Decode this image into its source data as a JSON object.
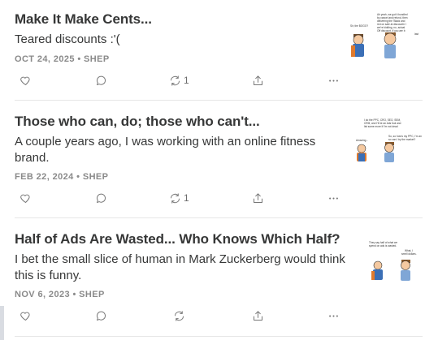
{
  "posts": [
    {
      "title": "Make It Make Cents...",
      "subtitle": "Teared discounts :'(",
      "meta": "OCT 24, 2025 • SHEP",
      "restack_count": "1",
      "thumb_text": [
        "Ah yeah, we got it bundled",
        "by cancel and refund, then",
        "delivering the 'Black and",
        "red on sale at discounts' l",
        "we're kidding, no, actual",
        "Off discount, if you are b",
        "last"
      ],
      "thumb_question": "Sir, the BOGO?"
    },
    {
      "title": "Those who can, do; those who can't...",
      "subtitle": "A couple years ago, I was working with an online fitness brand.",
      "meta": "FEB 22, 2024 • SHEP",
      "restack_count": "1",
      "thumb_text": [
        "I do the PPC, CRO, SEO, SEM,",
        "CRM, and I'll be an Ads fool and",
        "list some more if I'm not dead"
      ],
      "thumb_left": "Amazing...",
      "thumb_right": "So, so how's my PPC, I'm an",
      "thumb_right2": "so can I try the market?"
    },
    {
      "title": "Half of Ads Are Wasted... Who Knows Which Half?",
      "subtitle": "I bet the small slice of human in Mark Zuckerberg would think this is funny.",
      "meta": "NOV 6, 2023 • SHEP",
      "restack_count": "",
      "thumb_text": [
        "They say half of what we",
        "spend on ads is wasted."
      ],
      "thumb_right": "What, I",
      "thumb_right2": "smell dollars."
    }
  ],
  "icons": {
    "like": "heart-icon",
    "comment": "comment-icon",
    "restack": "restack-icon",
    "share": "share-icon",
    "more": "more-icon"
  },
  "colors": {
    "text": "#363737",
    "meta": "#8a8a8a",
    "icon": "#777777",
    "divider": "#e6e6e6"
  }
}
